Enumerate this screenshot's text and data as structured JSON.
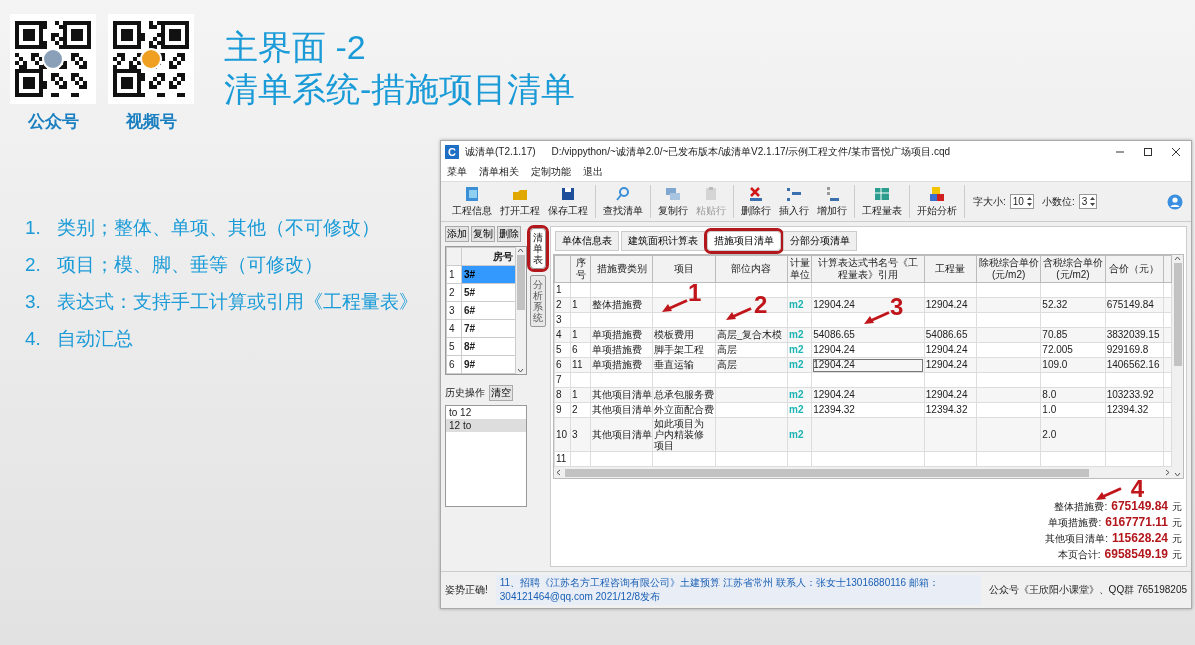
{
  "slide": {
    "qr_codes": [
      {
        "label": "公众号"
      },
      {
        "label": "视频号"
      }
    ],
    "title_lines": [
      "主界面 -2",
      "清单系统-措施项目清单"
    ],
    "bullets": [
      {
        "num": "1.",
        "text": "类别；整体、单项、其他（不可修改）"
      },
      {
        "num": "2.",
        "text": "项目；模、脚、垂等（可修改）"
      },
      {
        "num": "3.",
        "text": "表达式：支持手工计算或引用《工程量表》"
      },
      {
        "num": "4.",
        "text": "自动汇总"
      }
    ]
  },
  "window": {
    "app_icon": "C",
    "title": "诚清单(T2.1.17)",
    "path": "D:/vippython/~诚清单2.0/~已发布版本/诚清单V2.1.17/示例工程文件/某市晋悦广场项目.cqd"
  },
  "menu": [
    "菜单",
    "清单相关",
    "定制功能",
    "退出"
  ],
  "toolbar": {
    "groups": [
      [
        {
          "label": "工程信息",
          "disabled": false
        },
        {
          "label": "打开工程",
          "disabled": false
        },
        {
          "label": "保存工程",
          "disabled": false
        }
      ],
      [
        {
          "label": "查找清单",
          "disabled": false
        }
      ],
      [
        {
          "label": "复制行",
          "disabled": false
        },
        {
          "label": "粘贴行",
          "disabled": true
        }
      ],
      [
        {
          "label": "删除行",
          "disabled": false
        },
        {
          "label": "插入行",
          "disabled": false
        },
        {
          "label": "增加行",
          "disabled": false
        }
      ],
      [
        {
          "label": "工程量表",
          "disabled": false
        }
      ],
      [
        {
          "label": "开始分析",
          "disabled": false
        }
      ]
    ],
    "spinners": [
      {
        "label": "字大小:",
        "value": "10"
      },
      {
        "label": "小数位:",
        "value": "3"
      }
    ]
  },
  "left_panel": {
    "buttons": [
      "添加",
      "复制",
      "删除"
    ],
    "room_header": "房号",
    "rooms": [
      {
        "no": "1",
        "room": "3#",
        "selected": true
      },
      {
        "no": "2",
        "room": "5#",
        "selected": false
      },
      {
        "no": "3",
        "room": "6#",
        "selected": false
      },
      {
        "no": "4",
        "room": "7#",
        "selected": false
      },
      {
        "no": "5",
        "room": "8#",
        "selected": false
      },
      {
        "no": "6",
        "room": "9#",
        "selected": false
      }
    ],
    "history_label": "历史操作",
    "history_clear": "清空",
    "history": [
      {
        "text": "to 12",
        "selected": false
      },
      {
        "text": "12 to",
        "selected": true
      }
    ]
  },
  "side_tabs": [
    {
      "label": "清单表",
      "selected": true,
      "highlighted": true
    },
    {
      "label": "分析系统",
      "selected": false,
      "highlighted": false
    }
  ],
  "tabs": [
    {
      "label": "单体信息表",
      "selected": false,
      "highlighted": false
    },
    {
      "label": "建筑面积计算表",
      "selected": false,
      "highlighted": false
    },
    {
      "label": "措施项目清单",
      "selected": true,
      "highlighted": true
    },
    {
      "label": "分部分项清单",
      "selected": false,
      "highlighted": false
    }
  ],
  "table": {
    "columns": [
      "序号",
      "措施费类别",
      "项目",
      "部位内容",
      "计量单位",
      "计算表达式书名号《工程量表》引用",
      "工程量",
      "除税综合单价(元/m2)",
      "含税综合单价(元/m2)",
      "合价（元）"
    ],
    "rows": [
      {
        "n": "1",
        "editing": false
      },
      {
        "n": "2",
        "seq": "1",
        "cat": "整体措施费",
        "unit": "m2",
        "expr": "12904.24",
        "qty": "12904.24",
        "pin": "52.32",
        "total": "675149.84",
        "editing": false
      },
      {
        "n": "3",
        "editing": false
      },
      {
        "n": "4",
        "seq": "1",
        "cat": "单项措施费",
        "item": "模板费用",
        "part": "高层_复合木模",
        "unit": "m2",
        "expr": "54086.65",
        "qty": "54086.65",
        "pin": "70.85",
        "total": "3832039.15",
        "editing": false
      },
      {
        "n": "5",
        "seq": "6",
        "cat": "单项措施费",
        "item": "脚手架工程",
        "part": "高层",
        "unit": "m2",
        "expr": "12904.24",
        "qty": "12904.24",
        "pin": "72.005",
        "total": "929169.8",
        "editing": false
      },
      {
        "n": "6",
        "seq": "11",
        "cat": "单项措施费",
        "item": "垂直运输",
        "part": "高层",
        "unit": "m2",
        "expr": "12904.24",
        "qty": "12904.24",
        "pin": "109.0",
        "total": "1406562.16",
        "editing": true
      },
      {
        "n": "7",
        "editing": false
      },
      {
        "n": "8",
        "seq": "1",
        "cat": "其他项目清单",
        "item": "总承包服务费",
        "unit": "m2",
        "expr": "12904.24",
        "qty": "12904.24",
        "pin": "8.0",
        "total": "103233.92",
        "editing": false
      },
      {
        "n": "9",
        "seq": "2",
        "cat": "其他项目清单",
        "item": "外立面配合费",
        "unit": "m2",
        "expr": "12394.32",
        "qty": "12394.32",
        "pin": "1.0",
        "total": "12394.32",
        "editing": false
      },
      {
        "n": "10",
        "seq": "3",
        "cat": "其他项目清单",
        "item": "如此项目为户内精装修项目",
        "unit": "m2",
        "pin": "2.0",
        "editing": false
      },
      {
        "n": "11",
        "editing": false
      }
    ]
  },
  "summary": [
    {
      "label": "整体措施费:",
      "value": "675149.84",
      "unit": "元"
    },
    {
      "label": "单项措施费:",
      "value": "6167771.11",
      "unit": "元"
    },
    {
      "label": "其他项目清单:",
      "value": "115628.24",
      "unit": "元"
    },
    {
      "label": "本页合计:",
      "value": "6958549.19",
      "unit": "元"
    }
  ],
  "annotations": [
    {
      "label": "1"
    },
    {
      "label": "2"
    },
    {
      "label": "3"
    },
    {
      "label": "4"
    }
  ],
  "status_bar": {
    "left": "姿势正确!",
    "middle": "11、招聘《江苏名方工程咨询有限公司》土建预算  江苏省常州  联系人：张女士13016880116  邮箱：304121464@qq.com  2021/12/8发布",
    "right": "公众号《王欣阳小课堂》、QQ群 765198205"
  }
}
